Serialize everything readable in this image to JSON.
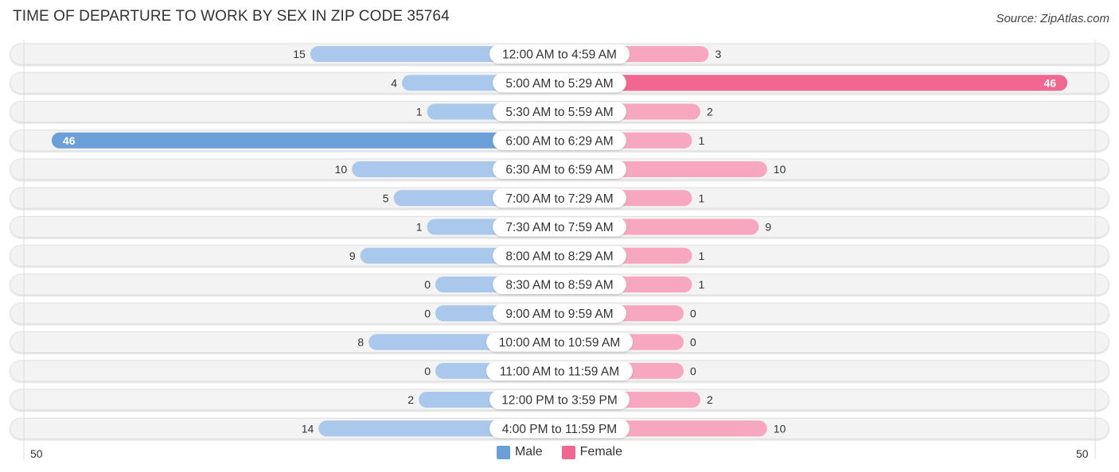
{
  "title": "TIME OF DEPARTURE TO WORK BY SEX IN ZIP CODE 35764",
  "source": "Source: ZipAtlas.com",
  "colors": {
    "male": "#6a9fd8",
    "male_light": "#a9c8ec",
    "female": "#f06892",
    "female_light": "#f7a8c0",
    "row_bg": "#f2f2f2"
  },
  "chart_data": {
    "type": "bar",
    "orientation": "horizontal-diverging",
    "title": "TIME OF DEPARTURE TO WORK BY SEX IN ZIP CODE 35764",
    "categories": [
      "12:00 AM to 4:59 AM",
      "5:00 AM to 5:29 AM",
      "5:30 AM to 5:59 AM",
      "6:00 AM to 6:29 AM",
      "6:30 AM to 6:59 AM",
      "7:00 AM to 7:29 AM",
      "7:30 AM to 7:59 AM",
      "8:00 AM to 8:29 AM",
      "8:30 AM to 8:59 AM",
      "9:00 AM to 9:59 AM",
      "10:00 AM to 10:59 AM",
      "11:00 AM to 11:59 AM",
      "12:00 PM to 3:59 PM",
      "4:00 PM to 11:59 PM"
    ],
    "series": [
      {
        "name": "Male",
        "values": [
          15,
          4,
          1,
          46,
          10,
          5,
          1,
          9,
          0,
          0,
          8,
          0,
          2,
          14
        ]
      },
      {
        "name": "Female",
        "values": [
          3,
          46,
          2,
          1,
          10,
          1,
          9,
          1,
          1,
          0,
          0,
          0,
          2,
          10
        ]
      }
    ],
    "axis": {
      "min_label": "50",
      "max_label": "50",
      "range": [
        50,
        50
      ]
    },
    "legend": {
      "position": "bottom-center",
      "entries": [
        "Male",
        "Female"
      ]
    },
    "grid": false
  }
}
